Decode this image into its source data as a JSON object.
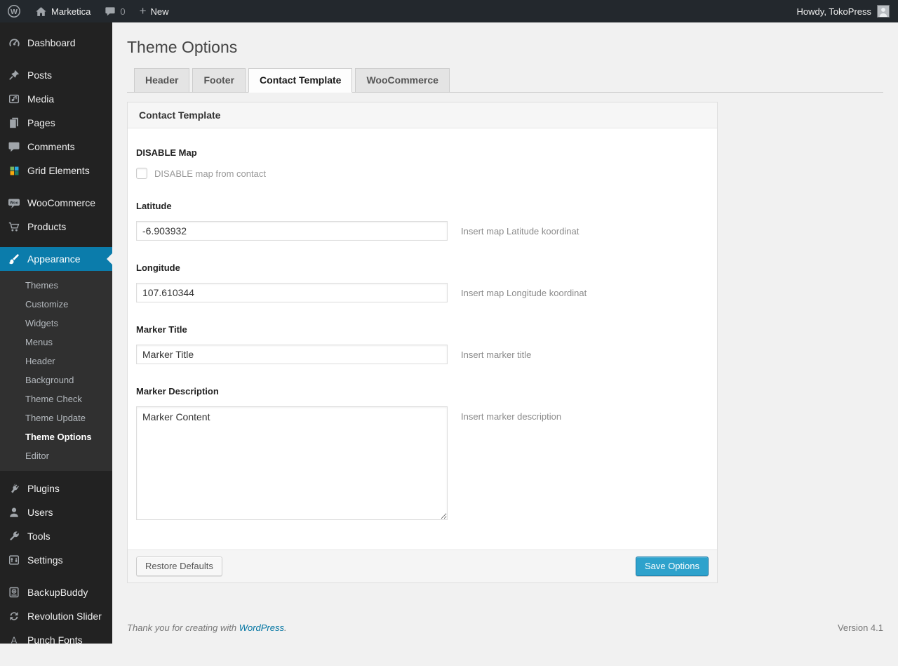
{
  "colors": {
    "accent": "#0074a2",
    "menu_highlight": "#0b7cab",
    "primary_button": "#2ea2cc",
    "sidebar_bg": "#222222",
    "adminbar_bg": "#23282d",
    "page_bg": "#f1f1f1"
  },
  "admin_bar": {
    "wp_logo_icon": "wordpress-icon",
    "home_icon": "home-icon",
    "site_name": "Marketica",
    "comments_icon": "comment-icon",
    "comments_count": "0",
    "new_icon": "plus-icon",
    "new_label": "New",
    "howdy": "Howdy, TokoPress",
    "avatar_icon": "user-avatar"
  },
  "sidebar": {
    "items": [
      {
        "label": "Dashboard",
        "icon": "dashboard-icon"
      },
      {
        "label": "Posts",
        "icon": "pushpin-icon"
      },
      {
        "label": "Media",
        "icon": "media-icon"
      },
      {
        "label": "Pages",
        "icon": "pages-icon"
      },
      {
        "label": "Comments",
        "icon": "comment-icon"
      },
      {
        "label": "Grid Elements",
        "icon": "grid-elements-icon"
      },
      {
        "label": "WooCommerce",
        "icon": "woocommerce-icon"
      },
      {
        "label": "Products",
        "icon": "cart-icon"
      },
      {
        "label": "Appearance",
        "icon": "paintbrush-icon",
        "current": true
      },
      {
        "label": "Plugins",
        "icon": "plugin-icon"
      },
      {
        "label": "Users",
        "icon": "user-icon"
      },
      {
        "label": "Tools",
        "icon": "wrench-icon"
      },
      {
        "label": "Settings",
        "icon": "sliders-icon"
      },
      {
        "label": "BackupBuddy",
        "icon": "backup-icon"
      },
      {
        "label": "Revolution Slider",
        "icon": "refresh-icon"
      },
      {
        "label": "Punch Fonts",
        "icon": "letter-a-icon"
      }
    ],
    "appearance_submenu": [
      {
        "label": "Themes"
      },
      {
        "label": "Customize"
      },
      {
        "label": "Widgets"
      },
      {
        "label": "Menus"
      },
      {
        "label": "Header"
      },
      {
        "label": "Background"
      },
      {
        "label": "Theme Check"
      },
      {
        "label": "Theme Update"
      },
      {
        "label": "Theme Options",
        "current": true
      },
      {
        "label": "Editor"
      }
    ]
  },
  "page": {
    "title": "Theme Options",
    "tabs": [
      {
        "label": "Header",
        "active": false
      },
      {
        "label": "Footer",
        "active": false
      },
      {
        "label": "Contact Template",
        "active": true
      },
      {
        "label": "WooCommerce",
        "active": false
      }
    ],
    "panel": {
      "header": "Contact Template",
      "fields": {
        "disable_map": {
          "label": "DISABLE Map",
          "checkbox_label": "DISABLE map from contact",
          "checked": false
        },
        "latitude": {
          "label": "Latitude",
          "value": "-6.903932",
          "help": "Insert map Latitude koordinat"
        },
        "longitude": {
          "label": "Longitude",
          "value": "107.610344",
          "help": "Insert map Longitude koordinat"
        },
        "marker_title": {
          "label": "Marker Title",
          "value": "Marker Title",
          "help": "Insert marker title"
        },
        "marker_description": {
          "label": "Marker Description",
          "value": "Marker Content",
          "help": "Insert marker description"
        }
      },
      "restore_button": "Restore Defaults",
      "save_button": "Save Options"
    }
  },
  "footer": {
    "thanks_prefix": "Thank you for creating with ",
    "thanks_link": "WordPress",
    "thanks_suffix": ".",
    "version": "Version 4.1"
  }
}
